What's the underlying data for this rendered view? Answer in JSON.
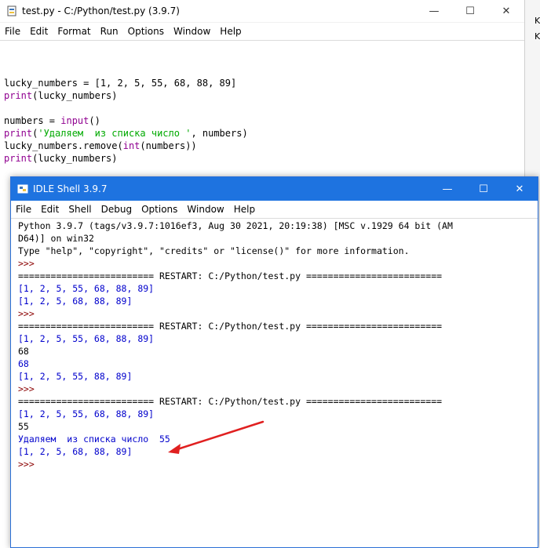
{
  "editor": {
    "title": "test.py - C:/Python/test.py (3.9.7)",
    "controls": {
      "minimize": "—",
      "maximize": "☐",
      "close": "✕"
    },
    "menu": [
      "File",
      "Edit",
      "Format",
      "Run",
      "Options",
      "Window",
      "Help"
    ],
    "code": {
      "line1": "lucky_numbers = [1, 2, 5, 55, 68, 88, 89]",
      "line2_kw": "print",
      "line2_rest": "(lucky_numbers)",
      "line4_a": "numbers = ",
      "line4_kw": "input",
      "line4_b": "()",
      "line5_kw": "print",
      "line5_a": "(",
      "line5_str": "'Удаляем  из списка число '",
      "line5_b": ", numbers)",
      "line6_a": "lucky_numbers.remove(",
      "line6_kw": "int",
      "line6_b": "(numbers))",
      "line7_kw": "print",
      "line7_rest": "(lucky_numbers)"
    },
    "side_letters": [
      "K",
      "K"
    ]
  },
  "shell": {
    "title": "IDLE Shell 3.9.7",
    "controls": {
      "minimize": "—",
      "maximize": "☐",
      "close": "✕"
    },
    "menu": [
      "File",
      "Edit",
      "Shell",
      "Debug",
      "Options",
      "Window",
      "Help"
    ],
    "banner1": "Python 3.9.7 (tags/v3.9.7:1016ef3, Aug 30 2021, 20:19:38) [MSC v.1929 64 bit (AM",
    "banner2": "D64)] on win32",
    "banner3": "Type \"help\", \"copyright\", \"credits\" or \"license()\" for more information.",
    "prompt": ">>>",
    "restart": "========================= RESTART: C:/Python/test.py =========================",
    "run1": [
      "[1, 2, 5, 55, 68, 88, 89]",
      "[1, 2, 5, 68, 88, 89]"
    ],
    "run2": {
      "out1": "[1, 2, 5, 55, 68, 88, 89]",
      "input": "68",
      "echo": "68",
      "out2": "[1, 2, 5, 55, 88, 89]"
    },
    "run3": {
      "out1": "[1, 2, 5, 55, 68, 88, 89]",
      "input": "55",
      "msg": "Удаляем  из списка число  55",
      "out2": "[1, 2, 5, 68, 88, 89]"
    }
  },
  "annotation": {
    "arrow_color": "#e02020"
  }
}
